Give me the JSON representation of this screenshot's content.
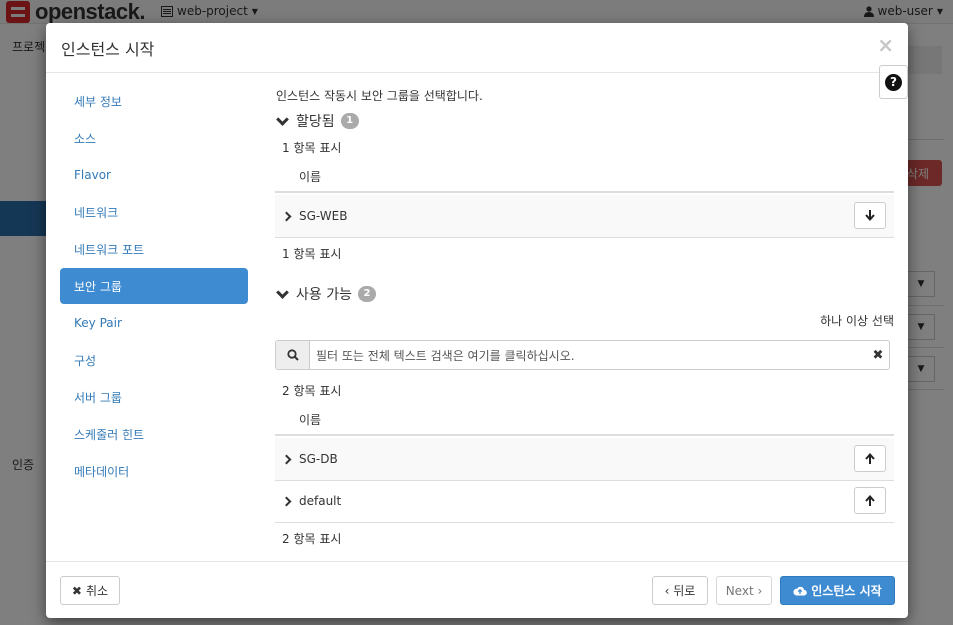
{
  "app": {
    "brand": "openstack.",
    "project": "web-project",
    "user": "web-user",
    "background_crumb": "프로젝트",
    "background_auth": "인증",
    "background_delete": "삭제"
  },
  "modal": {
    "title": "인스턴스 시작",
    "close_symbol": "×",
    "help_symbol": "?",
    "nav": [
      {
        "label": "세부 정보"
      },
      {
        "label": "소스"
      },
      {
        "label": "Flavor"
      },
      {
        "label": "네트워크"
      },
      {
        "label": "네트워크 포트"
      },
      {
        "label": "보안 그룹",
        "active": true
      },
      {
        "label": "Key Pair"
      },
      {
        "label": "구성"
      },
      {
        "label": "서버 그룹"
      },
      {
        "label": "스케줄러 힌트"
      },
      {
        "label": "메타데이터"
      }
    ],
    "intro": "인스턴스 작동시 보안 그룹을 선택합니다.",
    "allocated": {
      "heading": "할당됨",
      "count": "1",
      "display_top": "1 항목 표시",
      "column": "이름",
      "rows": [
        {
          "name": "SG-WEB",
          "action": "down-arrow-icon"
        }
      ],
      "display_bottom": "1 항목 표시"
    },
    "available": {
      "heading": "사용 가능",
      "count": "2",
      "select_hint": "하나 이상 선택",
      "filter_placeholder": "필터 또는 전체 텍스트 검색은 여기를 클릭하십시오.",
      "clear_symbol": "✖",
      "display_top": "2 항목 표시",
      "column": "이름",
      "rows": [
        {
          "name": "SG-DB",
          "action": "up-arrow-icon"
        },
        {
          "name": "default",
          "action": "up-arrow-icon"
        }
      ],
      "display_bottom": "2 항목 표시"
    },
    "footer": {
      "cancel": "취소",
      "back": "‹ 뒤로",
      "next": "Next ›",
      "launch": "인스턴스 시작"
    }
  },
  "colors": {
    "primary": "#3e8bd2",
    "link": "#337ab7",
    "danger": "#d9534f",
    "brand_red": "#d9262c"
  }
}
